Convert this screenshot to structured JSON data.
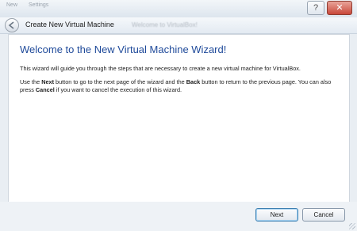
{
  "window": {
    "title": "Create New Virtual Machine",
    "background_title": "Welcome to VirtualBox!",
    "background_items": [
      "New",
      "Settings"
    ],
    "caption_buttons": [
      "?",
      "✕"
    ]
  },
  "wizard": {
    "heading": "Welcome to the New Virtual Machine Wizard!",
    "intro": "This wizard will guide you through the steps that are necessary to create a new virtual machine for VirtualBox.",
    "instructions": {
      "part1": "Use the ",
      "next_word": "Next",
      "part2": " button to go to the next page of the wizard and the ",
      "back_word": "Back",
      "part3": " button to return to the previous page. You can also press ",
      "cancel_word": "Cancel",
      "part4": " if you want to cancel the execution of this wizard."
    }
  },
  "buttons": {
    "next": "Next",
    "cancel": "Cancel",
    "back_icon": "back-arrow-icon"
  },
  "colors": {
    "heading": "#1f4a9a",
    "panel": "#ffffff",
    "frame": "#e9eef3"
  }
}
